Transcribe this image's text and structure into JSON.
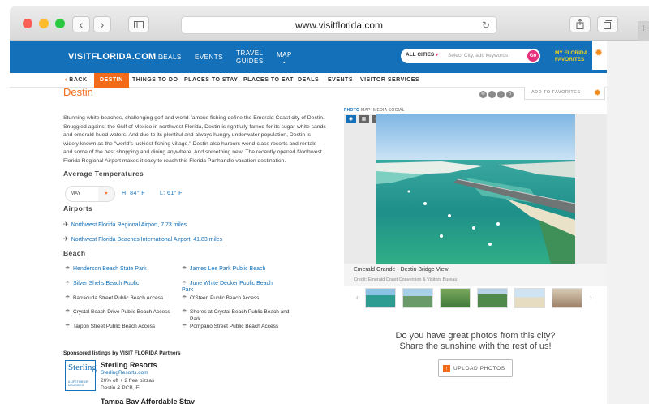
{
  "browser": {
    "url": "www.visitflorida.com",
    "back_icon": "chevron-left-icon",
    "forward_icon": "chevron-right-icon",
    "sidebar_icon": "sidebar-icon",
    "reload_icon": "reload-icon",
    "share_icon": "share-icon",
    "tabs_icon": "tabs-icon",
    "new_tab": "+"
  },
  "site": {
    "logo": "VISITFLORIDA.COM",
    "nav": [
      "DEALS",
      "EVENTS",
      "TRAVEL",
      "GUIDES",
      "MAP"
    ],
    "search": {
      "city_label": "ALL CITIES",
      "placeholder": "Select City, add keywords",
      "go": "Go"
    },
    "favorites": [
      "MY FLORIDA",
      "FAVORITES"
    ]
  },
  "subnav": {
    "back": "BACK",
    "items": [
      "DESTIN",
      "THINGS TO DO",
      "PLACES TO STAY",
      "PLACES TO EAT",
      "DEALS",
      "EVENTS",
      "VISITOR SERVICES"
    ]
  },
  "main": {
    "title": "Destin",
    "add_to_favorites": "ADD TO FAVORITES",
    "description": "Stunning white beaches, challenging golf and world-famous fishing define the Emerald Coast city of Destin. Snuggled against the Gulf of Mexico in northwest Florida, Destin is rightfully famed for its sugar-white sands and emerald-hued waters. And due to its plentiful and always hungry underwater population, Destin is widely known as the \"world's luckiest fishing village.\" Destin also harbors world-class resorts and rentals – and some of the best shopping and dining anywhere. And something new: The recently opened Northwest Florida Regional Airport makes it easy to reach this Florida Panhandle vacation destination.",
    "avg_temp_heading": "Average Temperatures",
    "month": "MAY",
    "high": "H: 84° F",
    "low": "L: 61° F",
    "airports_heading": "Airports",
    "airports": [
      "Northwest Florida Regional Airport, 7.73 miles",
      "Northwest Florida Beaches International Airport, 41.83 miles"
    ],
    "beach_heading": "Beach",
    "beaches_left": [
      "Henderson Beach State Park",
      "Silver Shells Beach Public",
      "Barracuda Street Public Beach Access",
      "Crystal Beach Drive Public Beach Access",
      "Tarpon Street Public Beach Access"
    ],
    "beaches_right": [
      "James Lee Park Public Beach",
      "June White Decker Public Beach",
      "Park",
      "O'Steen Public Beach Access",
      "Shores at Crystal Beach Public Beach and",
      "Park",
      "Pompano Street Public Beach Access"
    ],
    "sponsored_heading": "Sponsored listings by VISIT FLORIDA Partners",
    "sponsor": {
      "logo_name": "Sterling",
      "logo_sub": "A LIFETIME OF MEMORIES",
      "name": "Sterling Resorts",
      "url": "SterlingResorts.com",
      "offer": "20% off + 2 free pizzas",
      "location": "Destin & PCB, FL"
    },
    "sponsor2_name": "Tampa Bay Affordable Stay"
  },
  "media": {
    "tabs": [
      "PHOTO",
      "MAP",
      "MEDIA SOCIAL"
    ],
    "caption": "Emerald Grande - Destin Bridge View",
    "credit": "Credit: Emerald Coast Convention & Visitors Bureau",
    "cta_line1": "Do you have great photos from this city?",
    "cta_line2": "Share the sunshine with the rest of us!",
    "upload": "UPLOAD PHOTOS"
  }
}
